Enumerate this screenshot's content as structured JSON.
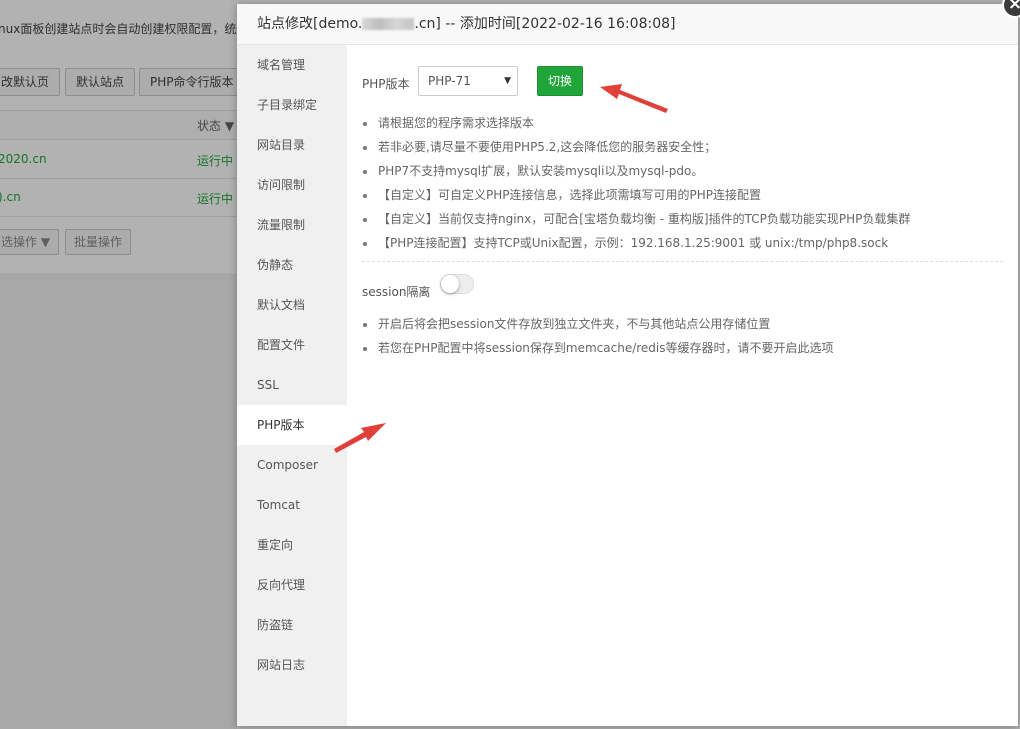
{
  "background": {
    "notice": "nux面板创建站点时会自动创建权限配置，统一",
    "toolbar": [
      "改默认页",
      "默认站点",
      "PHP命令行版本"
    ],
    "table": {
      "status_header": "状态",
      "rows": [
        {
          "domain": "2020.cn",
          "status": "运行中"
        },
        {
          "domain": ").cn",
          "status": "运行中"
        }
      ]
    },
    "batch_select": "选操作",
    "batch_button": "批量操作"
  },
  "dialog": {
    "title_prefix": "站点修改[demo.",
    "title_suffix": ".cn] -- 添加时间[2022-02-16 16:08:08]",
    "close": "×",
    "sidebar": [
      "域名管理",
      "子目录绑定",
      "网站目录",
      "访问限制",
      "流量限制",
      "伪静态",
      "默认文档",
      "配置文件",
      "SSL",
      "PHP版本",
      "Composer",
      "Tomcat",
      "重定向",
      "反向代理",
      "防盗链",
      "网站日志"
    ],
    "active_item": "PHP版本",
    "php": {
      "label": "PHP版本",
      "selected": "PHP-71",
      "switch_button": "切换"
    },
    "tips": [
      "请根据您的程序需求选择版本",
      "若非必要,请尽量不要使用PHP5.2,这会降低您的服务器安全性；",
      "PHP7不支持mysql扩展，默认安装mysqli以及mysql-pdo。",
      "【自定义】可自定义PHP连接信息，选择此项需填写可用的PHP连接配置",
      "【自定义】当前仅支持nginx，可配合[宝塔负载均衡 - 重构版]插件的TCP负载功能实现PHP负载集群",
      "【PHP连接配置】支持TCP或Unix配置，示例：192.168.1.25:9001 或 unix:/tmp/php8.sock"
    ],
    "session": {
      "label": "session隔离",
      "enabled": false
    },
    "session_tips": [
      "开启后将会把session文件存放到独立文件夹，不与其他站点公用存储位置",
      "若您在PHP配置中将session保存到memcache/redis等缓存器时，请不要开启此选项"
    ]
  },
  "colors": {
    "accent_green": "#20a53a",
    "annotation_red": "#e0403a",
    "overlay": "rgba(0,0,0,0.3)"
  }
}
